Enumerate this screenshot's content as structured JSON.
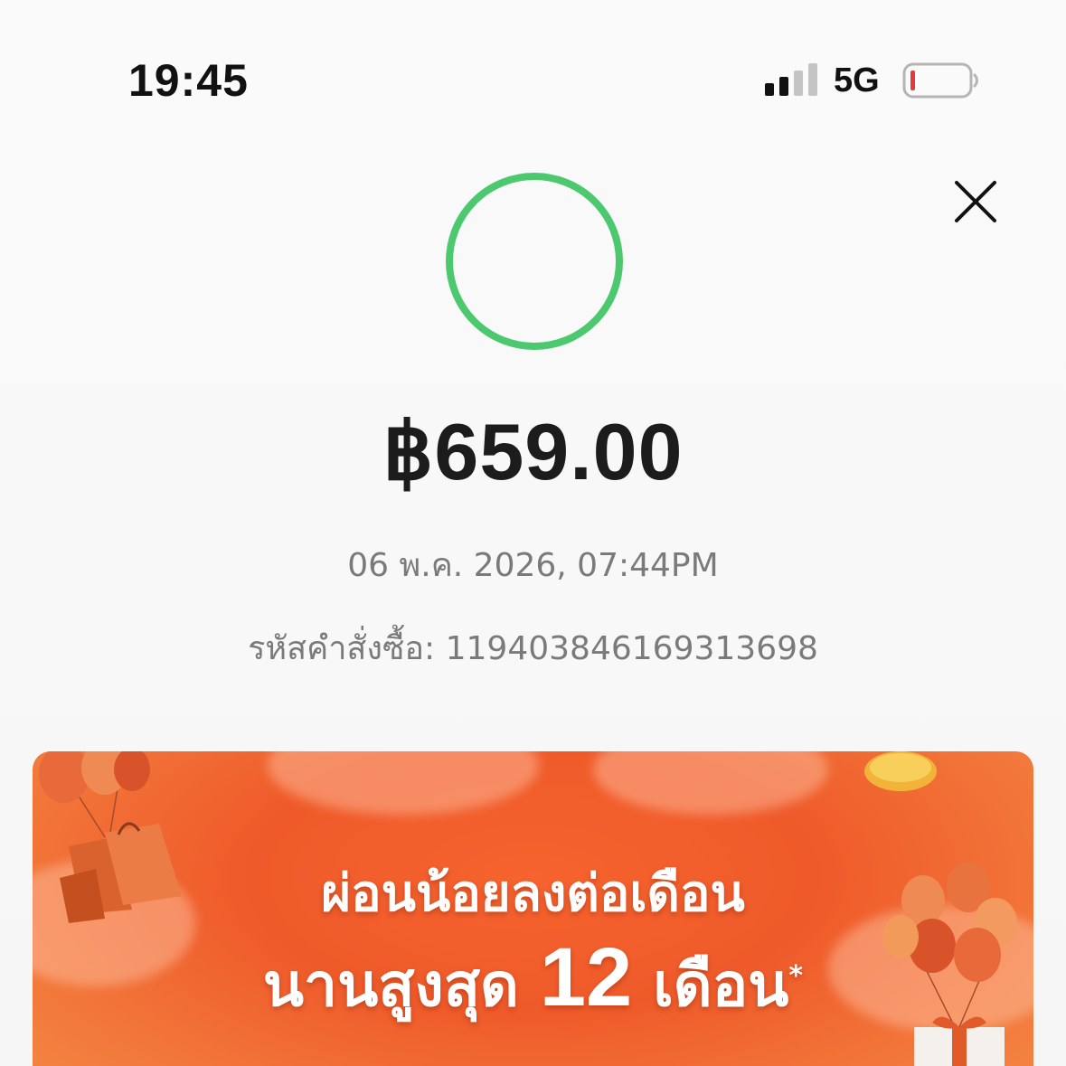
{
  "status_bar": {
    "time": "19:45",
    "network": "5G",
    "signal_bars_active": 2,
    "signal_bars_total": 4,
    "battery_level": 0.05
  },
  "icons": {
    "close": "close-icon",
    "success": "success-circle-icon",
    "signal": "cellular-signal-icon",
    "battery": "battery-low-icon"
  },
  "receipt": {
    "amount": "฿659.00",
    "datetime": "06 พ.ค. 2026, 07:44PM",
    "order_label": "รหัสคำสั่งซื้อ:",
    "order_id": "119403846169313698"
  },
  "banner": {
    "line1": "ผ่อนน้อยลงต่อเดือน",
    "line2_prefix": "นานสูงสุด",
    "line2_number": "12",
    "line2_suffix": "เดือน",
    "footnote_mark": "*"
  },
  "colors": {
    "success_green": "#4cc96e",
    "banner_orange": "#ef5a2a",
    "battery_red": "#e23b3b"
  }
}
